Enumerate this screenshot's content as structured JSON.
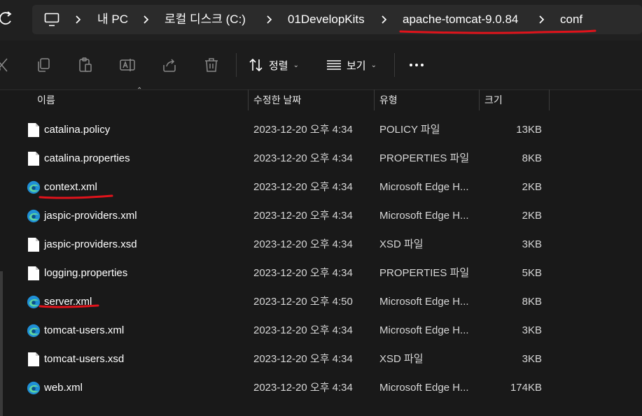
{
  "address_bar": {
    "breadcrumbs": [
      "내 PC",
      "로컬 디스크 (C:)",
      "01DevelopKits",
      "apache-tomcat-9.0.84",
      "conf"
    ],
    "icons": {
      "computer": "computer-icon",
      "separator": "chevron-right-icon",
      "refresh": "refresh-icon"
    }
  },
  "toolbar": {
    "sort_label": "정렬",
    "view_label": "보기",
    "icons": [
      "cut-icon",
      "copy-icon",
      "paste-icon",
      "rename-icon",
      "share-icon",
      "delete-icon",
      "sort-icon",
      "view-icon",
      "more-icon"
    ]
  },
  "columns": {
    "name": "이름",
    "modified": "수정한 날짜",
    "type": "유형",
    "size": "크기"
  },
  "files": [
    {
      "name": "catalina.policy",
      "modified": "2023-12-20 오후 4:34",
      "type": "POLICY 파일",
      "size": "13KB",
      "icon": "document-icon"
    },
    {
      "name": "catalina.properties",
      "modified": "2023-12-20 오후 4:34",
      "type": "PROPERTIES 파일",
      "size": "8KB",
      "icon": "document-icon"
    },
    {
      "name": "context.xml",
      "modified": "2023-12-20 오후 4:34",
      "type": "Microsoft Edge H...",
      "size": "2KB",
      "icon": "edge-icon"
    },
    {
      "name": "jaspic-providers.xml",
      "modified": "2023-12-20 오후 4:34",
      "type": "Microsoft Edge H...",
      "size": "2KB",
      "icon": "edge-icon"
    },
    {
      "name": "jaspic-providers.xsd",
      "modified": "2023-12-20 오후 4:34",
      "type": "XSD 파일",
      "size": "3KB",
      "icon": "document-icon"
    },
    {
      "name": "logging.properties",
      "modified": "2023-12-20 오후 4:34",
      "type": "PROPERTIES 파일",
      "size": "5KB",
      "icon": "document-icon"
    },
    {
      "name": "server.xml",
      "modified": "2023-12-20 오후 4:50",
      "type": "Microsoft Edge H...",
      "size": "8KB",
      "icon": "edge-icon"
    },
    {
      "name": "tomcat-users.xml",
      "modified": "2023-12-20 오후 4:34",
      "type": "Microsoft Edge H...",
      "size": "3KB",
      "icon": "edge-icon"
    },
    {
      "name": "tomcat-users.xsd",
      "modified": "2023-12-20 오후 4:34",
      "type": "XSD 파일",
      "size": "3KB",
      "icon": "document-icon"
    },
    {
      "name": "web.xml",
      "modified": "2023-12-20 오후 4:34",
      "type": "Microsoft Edge H...",
      "size": "174KB",
      "icon": "edge-icon"
    }
  ],
  "colors": {
    "background": "#191919",
    "annotation_red": "#e0131b",
    "text_primary": "#ffffff",
    "text_secondary": "#d6d6d6"
  }
}
